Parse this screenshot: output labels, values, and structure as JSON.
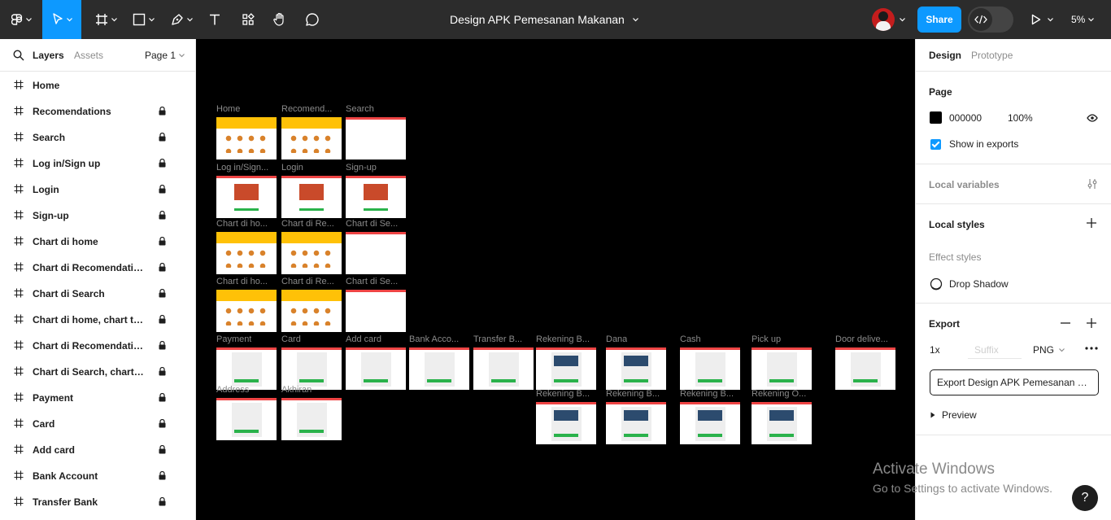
{
  "toolbar": {
    "document_title": "Design APK Pemesanan Makanan",
    "share_label": "Share",
    "zoom": "5%"
  },
  "left_panel": {
    "tab_layers": "Layers",
    "tab_assets": "Assets",
    "page": "Page 1",
    "layers": [
      {
        "name": "Home",
        "locked": false
      },
      {
        "name": "Recomendations",
        "locked": true
      },
      {
        "name": "Search",
        "locked": true
      },
      {
        "name": "Log in/Sign up",
        "locked": true
      },
      {
        "name": "Login",
        "locked": true
      },
      {
        "name": "Sign-up",
        "locked": true
      },
      {
        "name": "Chart di home",
        "locked": true
      },
      {
        "name": "Chart di Recomendations",
        "locked": true
      },
      {
        "name": "Chart di Search",
        "locked": true
      },
      {
        "name": "Chart di home, chart terisi",
        "locked": true
      },
      {
        "name": "Chart di Recomendation...",
        "locked": true
      },
      {
        "name": "Chart di Search, chart te...",
        "locked": true
      },
      {
        "name": "Payment",
        "locked": true
      },
      {
        "name": "Card",
        "locked": true
      },
      {
        "name": "Add card",
        "locked": true
      },
      {
        "name": "Bank Account",
        "locked": true
      },
      {
        "name": "Transfer Bank",
        "locked": true
      }
    ]
  },
  "right_panel": {
    "tab_design": "Design",
    "tab_prototype": "Prototype",
    "page_title": "Page",
    "page_color": "000000",
    "page_opacity": "100%",
    "show_in_exports": "Show in exports",
    "local_variables": "Local variables",
    "local_styles": "Local styles",
    "effect_styles": "Effect styles",
    "drop_shadow": "Drop Shadow",
    "export_title": "Export",
    "export_scale": "1x",
    "export_suffix_placeholder": "Suffix",
    "export_format": "PNG",
    "export_button": "Export Design APK Pemesanan Makanan",
    "preview": "Preview"
  },
  "canvas": {
    "frames": [
      {
        "label": "Home",
        "style": "yellow"
      },
      {
        "label": "Recomend...",
        "style": "yellow"
      },
      {
        "label": "Search",
        "style": "blank"
      },
      {
        "label": "Log in/Sign...",
        "style": "login"
      },
      {
        "label": "Login",
        "style": "login"
      },
      {
        "label": "Sign-up",
        "style": "login"
      },
      {
        "label": "Chart di ho...",
        "style": "yellow"
      },
      {
        "label": "Chart di Re...",
        "style": "yellow"
      },
      {
        "label": "Chart di Se...",
        "style": "blank"
      },
      {
        "label": "Chart di ho...",
        "style": "yellow"
      },
      {
        "label": "Chart di Re...",
        "style": "yellow"
      },
      {
        "label": "Chart di Se...",
        "style": "blank"
      },
      {
        "label": "Payment",
        "style": "card"
      },
      {
        "label": "Card",
        "style": "card"
      },
      {
        "label": "Add card",
        "style": "card"
      },
      {
        "label": "Bank Acco...",
        "style": "card"
      },
      {
        "label": "Transfer B...",
        "style": "card"
      },
      {
        "label": "Rekening B...",
        "style": "bank"
      },
      {
        "label": "Dana",
        "style": "bank"
      },
      {
        "label": "Cash",
        "style": "card"
      },
      {
        "label": "Pick up",
        "style": "card"
      },
      {
        "label": "Door delive...",
        "style": "card"
      },
      {
        "label": "Address",
        "style": "card"
      },
      {
        "label": "Akhiran",
        "style": "card"
      },
      {
        "label": "Rekening B...",
        "style": "bank"
      },
      {
        "label": "Rekening B...",
        "style": "bank"
      },
      {
        "label": "Rekening B...",
        "style": "bank"
      },
      {
        "label": "Rekening O...",
        "style": "bank"
      }
    ]
  },
  "watermark": {
    "title": "Activate Windows",
    "subtitle": "Go to Settings to activate Windows."
  },
  "help_label": "?"
}
